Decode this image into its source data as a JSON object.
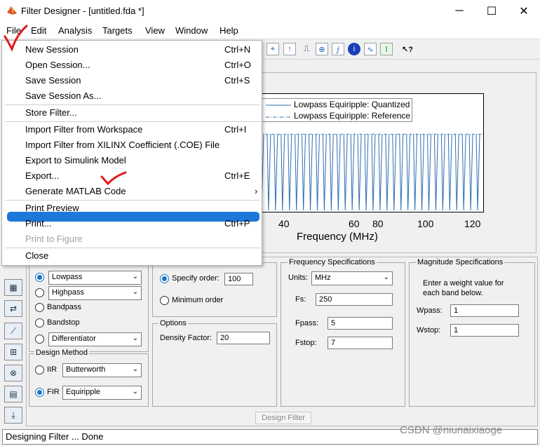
{
  "window": {
    "title": "Filter Designer -  [untitled.fda *]",
    "minimize": "─",
    "maximize": "☐",
    "close": "✕"
  },
  "menubar": [
    "File",
    "Edit",
    "Analysis",
    "Targets",
    "View",
    "Window",
    "Help"
  ],
  "file_menu": {
    "items": [
      {
        "label": "New Session",
        "shortcut": "Ctrl+N",
        "state": "normal"
      },
      {
        "label": "Open Session...",
        "shortcut": "Ctrl+O",
        "state": "normal"
      },
      {
        "label": "Save Session",
        "shortcut": "Ctrl+S",
        "state": "normal"
      },
      {
        "label": "Save Session As...",
        "shortcut": "",
        "state": "normal"
      },
      {
        "label": "Store Filter...",
        "shortcut": "",
        "state": "normal"
      },
      {
        "label": "Import Filter from Workspace",
        "shortcut": "Ctrl+I",
        "state": "normal"
      },
      {
        "label": "Import Filter from XILINX Coefficient (.COE) File",
        "shortcut": "",
        "state": "normal"
      },
      {
        "label": "Export to Simulink Model",
        "shortcut": "",
        "state": "normal"
      },
      {
        "label": "Export...",
        "shortcut": "Ctrl+E",
        "state": "highlighted"
      },
      {
        "label": "Generate MATLAB Code",
        "shortcut": "›",
        "state": "normal"
      },
      {
        "label": "Print Preview",
        "shortcut": "",
        "state": "normal"
      },
      {
        "label": "Print...",
        "shortcut": "Ctrl+P",
        "state": "normal"
      },
      {
        "label": "Print to Figure",
        "shortcut": "",
        "state": "disabled"
      },
      {
        "label": "Close",
        "shortcut": "",
        "state": "normal"
      }
    ]
  },
  "plot": {
    "legend": [
      "Lowpass Equiripple: Quantized",
      "Lowpass Equiripple: Reference"
    ],
    "xticks": [
      "40",
      "60",
      "80",
      "100",
      "120"
    ],
    "xlabel": "Frequency (MHz)",
    "line_color": "#2a6db0"
  },
  "response_type": {
    "options": [
      "Lowpass",
      "Highpass",
      "Bandpass",
      "Bandstop",
      "Differentiator"
    ],
    "selected": "Lowpass",
    "lowpass_dropdown": "Lowpass",
    "highpass_dropdown": "Highpass",
    "differentiator_dropdown": "Differentiator"
  },
  "design_method": {
    "title": "Design Method",
    "iir_label": "IIR",
    "iir_value": "Butterworth",
    "fir_label": "FIR",
    "fir_value": "Equiripple",
    "selected": "FIR"
  },
  "filter_order": {
    "specify_label": "Specify order:",
    "specify_value": "100",
    "minimum_label": "Minimum order",
    "selected": "specify"
  },
  "options": {
    "title": "Options",
    "density_label": "Density Factor:",
    "density_value": "20"
  },
  "frequency_specs": {
    "title": "Frequency Specifications",
    "units_label": "Units:",
    "units_value": "MHz",
    "fs_label": "Fs:",
    "fs_value": "250",
    "fpass_label": "Fpass:",
    "fpass_value": "5",
    "fstop_label": "Fstop:",
    "fstop_value": "7"
  },
  "magnitude_specs": {
    "title": "Magnitude Specifications",
    "note_line1": "Enter a weight value for",
    "note_line2": "each band below.",
    "wpass_label": "Wpass:",
    "wpass_value": "1",
    "wstop_label": "Wstop:",
    "wstop_value": "1"
  },
  "design_button": "Design Filter",
  "status": "Designing Filter ... Done",
  "watermark": "CSDN @niunaixiaoge",
  "accent_color": "#1e78d8",
  "annotation_color": "#e0191b"
}
